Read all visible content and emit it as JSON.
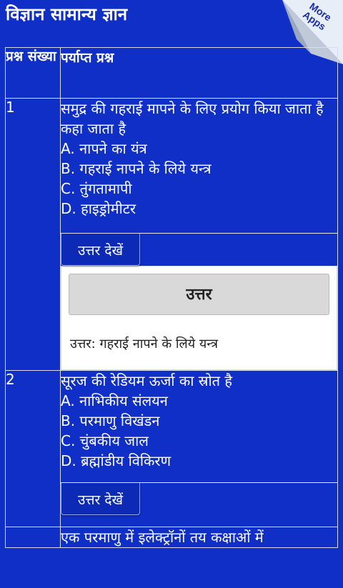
{
  "app": {
    "title": "विज्ञान सामान्य ज्ञान"
  },
  "corner": {
    "line1": "More",
    "line2": "Apps"
  },
  "table": {
    "col_num": "प्रश्न संख्या",
    "col_question": "पर्याप्त प्रश्न",
    "rows": [
      {
        "num": "1",
        "question": "समुद्र की गहराई मापने के लिए प्रयोग किया जाता है कहा जाता है",
        "options": [
          "A. नापने का यंत्र",
          "B. गहराई नापने के लिये यन्त्र",
          "C. तुंगतामापी",
          "D. हाइड्रोमीटर"
        ],
        "button": "उत्तर देखें",
        "answer_heading": "उत्तर",
        "answer_text": "उत्तर: गहराई नापने के लिये यन्त्र"
      },
      {
        "num": "2",
        "question": "सूरज की रेडियम ऊर्जा का स्रोत है",
        "options": [
          "A. नाभिकीय संलयन",
          "B. परमाणु विखंडन",
          "C. चुंबकीय जाल",
          "D. ब्रह्मांडीय विकिरण"
        ],
        "button": "उत्तर देखें"
      },
      {
        "question": "एक परमाणु में इलेक्ट्रॉनों तय कक्षाओं में"
      }
    ]
  }
}
